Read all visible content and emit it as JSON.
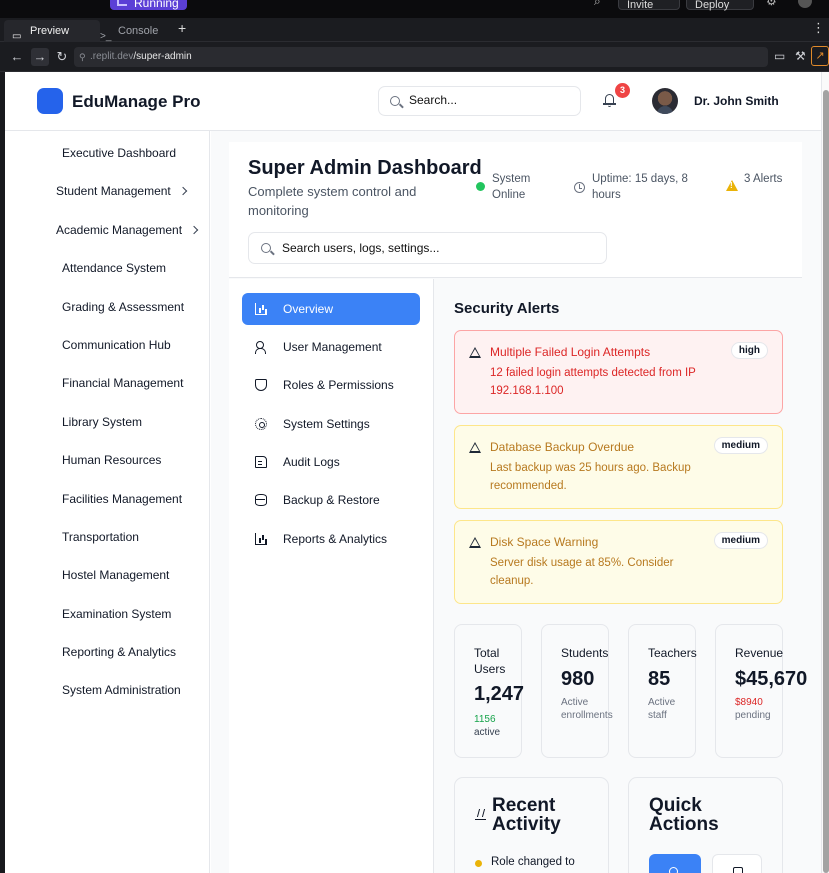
{
  "browser": {
    "running_label": "Running",
    "invite_label": "Invite",
    "deploy_label": "Deploy",
    "tabs": [
      {
        "label": "Preview"
      },
      {
        "label": "Console"
      }
    ],
    "url_host": ".replit.dev",
    "url_path": "/super-admin"
  },
  "app": {
    "brand": "EduManage Pro",
    "search_placeholder": "Search...",
    "notification_count": "3",
    "user_name": "Dr. John Smith"
  },
  "sidebar": {
    "items": [
      {
        "label": "Executive Dashboard"
      },
      {
        "label": "Student Management"
      },
      {
        "label": "Academic Management"
      },
      {
        "label": "Attendance System"
      },
      {
        "label": "Grading & Assessment"
      },
      {
        "label": "Communication Hub"
      },
      {
        "label": "Financial Management"
      },
      {
        "label": "Library System"
      },
      {
        "label": "Human Resources"
      },
      {
        "label": "Facilities Management"
      },
      {
        "label": "Transportation"
      },
      {
        "label": "Hostel Management"
      },
      {
        "label": "Examination System"
      },
      {
        "label": "Reporting & Analytics"
      },
      {
        "label": "System Administration"
      }
    ]
  },
  "dashboard": {
    "title": "Super Admin Dashboard",
    "subtitle": "Complete system control and monitoring",
    "status": {
      "online": "System Online",
      "uptime": "Uptime: 15 days, 8 hours",
      "alerts": "3 Alerts"
    },
    "search_placeholder": "Search users, logs, settings..."
  },
  "subnav": {
    "items": [
      {
        "label": "Overview",
        "icon": "bar-chart-icon"
      },
      {
        "label": "User Management",
        "icon": "users-icon"
      },
      {
        "label": "Roles & Permissions",
        "icon": "shield-icon"
      },
      {
        "label": "System Settings",
        "icon": "gear-icon"
      },
      {
        "label": "Audit Logs",
        "icon": "file-text-icon"
      },
      {
        "label": "Backup & Restore",
        "icon": "database-icon"
      },
      {
        "label": "Reports & Analytics",
        "icon": "bar-chart-icon"
      }
    ]
  },
  "security": {
    "title": "Security Alerts",
    "alerts": [
      {
        "title": "Multiple Failed Login Attempts",
        "body": "12 failed login attempts detected from IP 192.168.1.100",
        "severity": "high"
      },
      {
        "title": "Database Backup Overdue",
        "body": "Last backup was 25 hours ago. Backup recommended.",
        "severity": "medium"
      },
      {
        "title": "Disk Space Warning",
        "body": "Server disk usage at 85%. Consider cleanup.",
        "severity": "medium"
      }
    ]
  },
  "stats": [
    {
      "label": "Total Users",
      "value": "1,247",
      "note_value": "1156",
      "note_text": "active"
    },
    {
      "label": "Students",
      "value": "980",
      "note_text": "Active enrollments"
    },
    {
      "label": "Teachers",
      "value": "85",
      "note_text": "Active staff"
    },
    {
      "label": "Revenue",
      "value": "$45,670",
      "note_value": "$8940",
      "note_text": "pending"
    }
  ],
  "recent_activity": {
    "title": "Recent Activity",
    "first_item": "Role changed to"
  },
  "quick_actions": {
    "title": "Quick Actions"
  },
  "colors": {
    "accent": "#3b82f6",
    "online": "#22c55e",
    "high": "#dc2626",
    "medium": "#b7791f"
  }
}
